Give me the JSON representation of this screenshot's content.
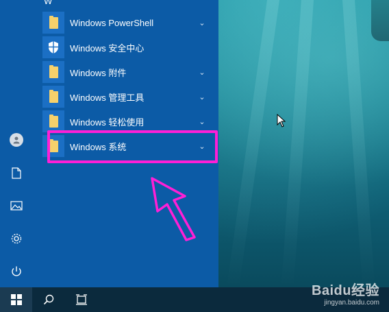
{
  "start_menu": {
    "section_letter": "W",
    "apps": [
      {
        "label": "Windows PowerShell",
        "icon": "folder-icon",
        "expandable": true
      },
      {
        "label": "Windows 安全中心",
        "icon": "shield-icon",
        "expandable": false
      },
      {
        "label": "Windows 附件",
        "icon": "folder-icon",
        "expandable": true
      },
      {
        "label": "Windows 管理工具",
        "icon": "folder-icon",
        "expandable": true
      },
      {
        "label": "Windows 轻松使用",
        "icon": "folder-icon",
        "expandable": true
      },
      {
        "label": "Windows 系统",
        "icon": "folder-icon",
        "expandable": true
      }
    ]
  },
  "left_rail": [
    "user-avatar-icon",
    "document-icon",
    "pictures-icon",
    "settings-gear-icon",
    "power-icon"
  ],
  "colors": {
    "menu_bg": "#0c5ba6",
    "tile_bg": "#1b6fc4",
    "highlight": "#ff1fd6",
    "taskbar_bg": "#0b2a3d"
  },
  "watermark": {
    "brand": "Baidu经验",
    "url": "jingyan.baidu.com"
  }
}
